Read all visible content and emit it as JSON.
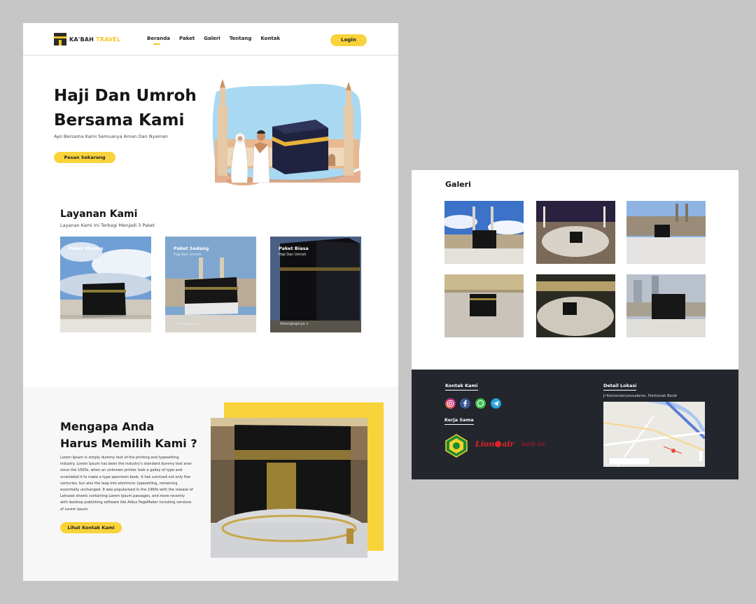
{
  "brand": {
    "name_main": "KA'BAH",
    "name_accent": "TRAVEL"
  },
  "nav": {
    "links": [
      "Beranda",
      "Paket",
      "Galeri",
      "Tentang",
      "Kontak"
    ],
    "login_label": "Login"
  },
  "hero": {
    "title_line1": "Haji Dan Umroh",
    "title_line2": "Bersama Kami",
    "subtitle": "Ayo Bersama Kami Semuanya Aman Dan Nyaman",
    "cta_label": "Pesan Sekarang"
  },
  "services": {
    "title": "Layanan Kami",
    "subtitle": "Layanan Kami Ini Terbagi Menjadi 3 Paket",
    "cards": [
      {
        "name": "Paket Khusus",
        "desc": "Haji Dan Umroh",
        "link": "Selengkapnya >"
      },
      {
        "name": "Paket Sedang",
        "desc": "Haji Dan Umroh",
        "link": "Selengkapnya >"
      },
      {
        "name": "Paket Biasa",
        "desc": "Haji Dan Umroh",
        "link": "Selengkapnya >"
      }
    ]
  },
  "why": {
    "title_line1": "Mengapa Anda",
    "title_line2": "Harus Memilih Kami ?",
    "body": "Lorem Ipsum is simply dummy text of the printing and typesetting industry. Lorem Ipsum has been the industry's standard dummy text ever since the 1500s, when an unknown printer took a galley of type and scrambled it to make a type specimen book. It has survived not only five centuries, but also the leap into electronic typesetting, remaining essentially unchanged. It was popularised in the 1960s with the release of Letraset sheets containing Lorem Ipsum passages, and more recently with desktop publishing software like Aldus PageMaker including versions of Lorem Ipsum",
    "cta_label": "Lihat Kontak Kami"
  },
  "gallery": {
    "title": "Galeri"
  },
  "footer": {
    "contact_heading": "Kontak Kami",
    "socials": [
      "instagram-icon",
      "facebook-icon",
      "whatsapp-icon",
      "telegram-icon"
    ],
    "partners_heading": "Kerja Sama",
    "partners": [
      "Lion",
      "air",
      "batik air"
    ],
    "location_heading": "Detail Lokasi",
    "address": "Jl Komondoryossudarso, Pontianak Barat"
  },
  "colors": {
    "accent": "#f8d33a",
    "footer_bg": "#23272d",
    "page_bg": "#c6c6c6"
  }
}
